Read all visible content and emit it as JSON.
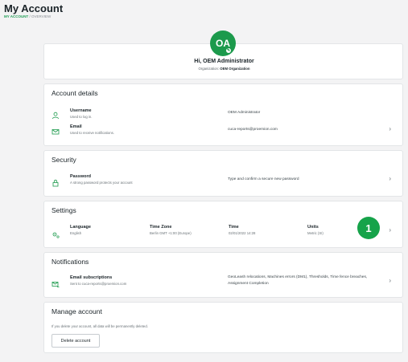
{
  "header": {
    "title": "My Account",
    "breadcrumb": [
      {
        "label": "MY ACCOUNT"
      },
      {
        "label": "OVERVIEW"
      }
    ],
    "separator": "/"
  },
  "profile": {
    "initials": "OA",
    "greeting": "Hi, OEM Administrator",
    "org_label": "Organization:",
    "org_value": "OEM Organization"
  },
  "account_details": {
    "title": "Account details",
    "username_label": "Username",
    "username_desc": "Used to log in.",
    "username_value": "OEM Administrator",
    "email_label": "Email",
    "email_desc": "Used to receive notifications.",
    "email_value": "cuca-reports@proemion.com"
  },
  "security": {
    "title": "Security",
    "password_label": "Password",
    "password_desc": "A strong password protects your account",
    "password_value": "Type and confirm a secure new password"
  },
  "settings": {
    "title": "Settings",
    "language_label": "Language",
    "language_value": "English",
    "timezone_label": "Time Zone",
    "timezone_value": "Berlin GMT +1:00 (Europe)",
    "time_label": "Time",
    "time_value": "02/01/2022 14:28",
    "units_label": "Units",
    "units_value": "Metric (SI)"
  },
  "notifications": {
    "title": "Notifications",
    "email_subs_label": "Email subscriptions",
    "email_subs_desc": "Sent to cuca-reports@proemion.com",
    "email_subs_value": "GeoLeash relocations, Machines errors (DM1), Thresholds, Time fence breaches, Assignment Completion"
  },
  "manage": {
    "title": "Manage account",
    "warning": "If you delete your account, all data will be permanently deleted.",
    "delete_button": "Delete account"
  },
  "step_badge": "1",
  "colors": {
    "accent": "#1c9a4c",
    "badge": "#16a34a"
  }
}
